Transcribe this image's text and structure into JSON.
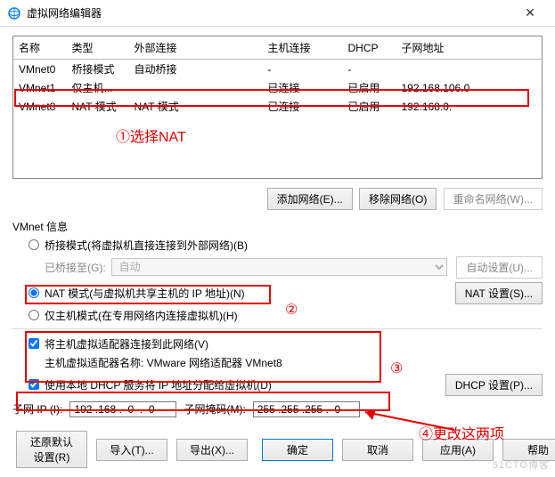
{
  "window": {
    "title": "虚拟网络编辑器"
  },
  "table": {
    "headers": [
      "名称",
      "类型",
      "外部连接",
      "主机连接",
      "DHCP",
      "子网地址"
    ],
    "rows": [
      {
        "name": "VMnet0",
        "type": "桥接模式",
        "ext": "自动桥接",
        "host": "-",
        "dhcp": "-",
        "subnet": ""
      },
      {
        "name": "VMnet1",
        "type": "仅主机...",
        "ext": "",
        "host": "已连接",
        "dhcp": "已启用",
        "subnet": "192.168.106.0"
      },
      {
        "name": "VMnet8",
        "type": "NAT 模式",
        "ext": "NAT 模式",
        "host": "已连接",
        "dhcp": "已启用",
        "subnet": "192.168.0."
      }
    ]
  },
  "annotations": {
    "a1": "①选择NAT",
    "a2": "②",
    "a3": "③",
    "a4": "④更改这两项"
  },
  "buttons": {
    "add_net": "添加网络(E)...",
    "remove_net": "移除网络(O)",
    "rename_net": "重命名网络(W)...",
    "auto_set": "自动设置(U)...",
    "nat_set": "NAT 设置(S)...",
    "dhcp_set": "DHCP 设置(P)...",
    "restore": "还原默认设置(R)",
    "import": "导入(T)...",
    "export": "导出(X)...",
    "ok": "确定",
    "cancel": "取消",
    "apply": "应用(A)",
    "help": "帮助"
  },
  "labels": {
    "vmnet_info": "VMnet 信息",
    "bridge_mode": "桥接模式(将虚拟机直接连接到外部网络)(B)",
    "bridged_to": "已桥接至(G):",
    "bridged_val": "自动",
    "nat_mode": "NAT 模式(与虚拟机共享主机的 IP 地址)(N)",
    "host_only": "仅主机模式(在专用网络内连接虚拟机)(H)",
    "connect_host": "将主机虚拟适配器连接到此网络(V)",
    "adapter_name": "主机虚拟适配器名称: VMware 网络适配器 VMnet8",
    "use_dhcp": "使用本地 DHCP 服务将 IP 地址分配给虚拟机(D)",
    "subnet_ip": "子网 IP (I):",
    "subnet_mask": "子网掩码(M):"
  },
  "values": {
    "subnet_ip": "192 .168 .  0  .  0",
    "subnet_mask": "255 .255 .255 .  0"
  },
  "watermark": "51CTO博客"
}
